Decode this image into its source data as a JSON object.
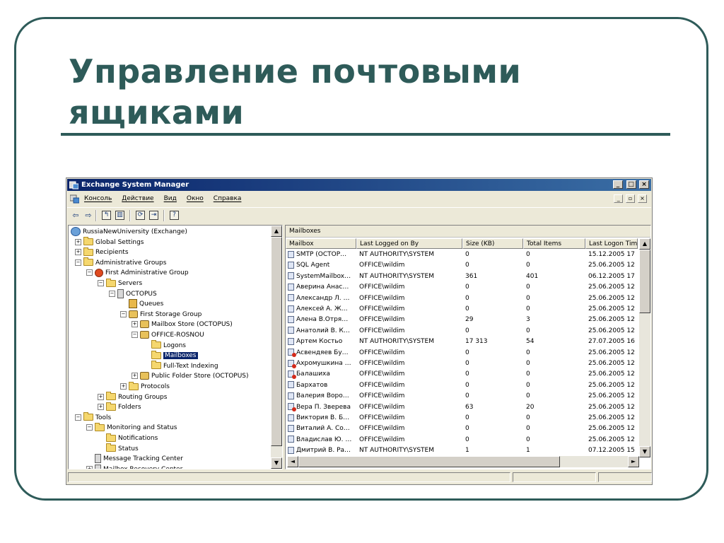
{
  "slide": {
    "title_line1": "Управление почтовыми",
    "title_line2": "ящиками",
    "colors": {
      "accent": "#2e5b59",
      "title_bar": "#0a246a",
      "selection": "#0a246a"
    }
  },
  "window": {
    "title": "Exchange System Manager",
    "caption_buttons": {
      "minimize": "_",
      "maximize": "□",
      "close": "×"
    },
    "menu": [
      "Консоль",
      "Действие",
      "Вид",
      "Окно",
      "Справка"
    ],
    "mdi_buttons": {
      "minimize": "_",
      "restore": "▫",
      "close": "×"
    },
    "toolbar": [
      {
        "name": "back-icon",
        "glyph": "⇦"
      },
      {
        "name": "forward-icon",
        "glyph": "⇨"
      },
      {
        "name": "up-folder-icon",
        "glyph": "↰"
      },
      {
        "name": "show-hide-tree-icon",
        "glyph": "▥"
      },
      {
        "name": "refresh-icon",
        "glyph": "⟳"
      },
      {
        "name": "export-list-icon",
        "glyph": "⇥"
      },
      {
        "name": "help-icon",
        "glyph": "?"
      }
    ]
  },
  "tree": [
    {
      "label": "RussiaNewUniversity (Exchange)",
      "expander": "",
      "icon": "globe"
    },
    {
      "label": "Global Settings",
      "expander": "+",
      "icon": "folder"
    },
    {
      "label": "Recipients",
      "expander": "+",
      "icon": "folder"
    },
    {
      "label": "Administrative Groups",
      "expander": "−",
      "icon": "folder"
    },
    {
      "label": "First Administrative Group",
      "expander": "−",
      "icon": "group"
    },
    {
      "label": "Servers",
      "expander": "−",
      "icon": "folder"
    },
    {
      "label": "OCTOPUS",
      "expander": "−",
      "icon": "server"
    },
    {
      "label": "Queues",
      "expander": "",
      "icon": "queue"
    },
    {
      "label": "First Storage Group",
      "expander": "−",
      "icon": "store"
    },
    {
      "label": "Mailbox Store (OCTOPUS)",
      "expander": "+",
      "icon": "store"
    },
    {
      "label": "OFFICE-ROSNOU",
      "expander": "−",
      "icon": "store"
    },
    {
      "label": "Logons",
      "expander": "",
      "icon": "folder"
    },
    {
      "label": "Mailboxes",
      "expander": "",
      "icon": "folder",
      "selected": true
    },
    {
      "label": "Full-Text Indexing",
      "expander": "",
      "icon": "folder"
    },
    {
      "label": "Public Folder Store (OCTOPUS)",
      "expander": "+",
      "icon": "store"
    },
    {
      "label": "Protocols",
      "expander": "+",
      "icon": "folder"
    },
    {
      "label": "Routing Groups",
      "expander": "+",
      "icon": "folder"
    },
    {
      "label": "Folders",
      "expander": "+",
      "icon": "folder"
    },
    {
      "label": "Tools",
      "expander": "−",
      "icon": "folder"
    },
    {
      "label": "Monitoring and Status",
      "expander": "−",
      "icon": "folder"
    },
    {
      "label": "Notifications",
      "expander": "",
      "icon": "folder"
    },
    {
      "label": "Status",
      "expander": "",
      "icon": "folder"
    },
    {
      "label": "Message Tracking Center",
      "expander": "",
      "icon": "server"
    },
    {
      "label": "Mailbox Recovery Center",
      "expander": "+",
      "icon": "server"
    }
  ],
  "list": {
    "caption": "Mailboxes",
    "columns": [
      "Mailbox",
      "Last Logged on By",
      "Size (KB)",
      "Total Items",
      "Last Logon Time"
    ],
    "rows": [
      {
        "mailbox": "SMTP (OCTOP…",
        "by": "NT AUTHORITY\\SYSTEM",
        "size": "0",
        "items": "0",
        "logon": "15.12.2005 17",
        "err": false
      },
      {
        "mailbox": "SQL Agent",
        "by": "OFFICE\\wildim",
        "size": "0",
        "items": "0",
        "logon": "25.06.2005 12",
        "err": false
      },
      {
        "mailbox": "SystemMailbox…",
        "by": "NT AUTHORITY\\SYSTEM",
        "size": "361",
        "items": "401",
        "logon": "06.12.2005 17",
        "err": false
      },
      {
        "mailbox": "Аверина Анас…",
        "by": "OFFICE\\wildim",
        "size": "0",
        "items": "0",
        "logon": "25.06.2005 12",
        "err": false
      },
      {
        "mailbox": "Александр Л. …",
        "by": "OFFICE\\wildim",
        "size": "0",
        "items": "0",
        "logon": "25.06.2005 12",
        "err": false
      },
      {
        "mailbox": "Алексей А. Ж…",
        "by": "OFFICE\\wildim",
        "size": "0",
        "items": "0",
        "logon": "25.06.2005 12",
        "err": false
      },
      {
        "mailbox": "Алена В.Отря…",
        "by": "OFFICE\\wildim",
        "size": "29",
        "items": "3",
        "logon": "25.06.2005 12",
        "err": false
      },
      {
        "mailbox": "Анатолий В. К…",
        "by": "OFFICE\\wildim",
        "size": "0",
        "items": "0",
        "logon": "25.06.2005 12",
        "err": false
      },
      {
        "mailbox": "Артем Костьо",
        "by": "NT AUTHORITY\\SYSTEM",
        "size": "17 313",
        "items": "54",
        "logon": "27.07.2005 16",
        "err": false
      },
      {
        "mailbox": "Асвендяев Бу…",
        "by": "OFFICE\\wildim",
        "size": "0",
        "items": "0",
        "logon": "25.06.2005 12",
        "err": true
      },
      {
        "mailbox": "Ахромушкина …",
        "by": "OFFICE\\wildim",
        "size": "0",
        "items": "0",
        "logon": "25.06.2005 12",
        "err": true
      },
      {
        "mailbox": "Балашиха",
        "by": "OFFICE\\wildim",
        "size": "0",
        "items": "0",
        "logon": "25.06.2005 12",
        "err": true
      },
      {
        "mailbox": "Бархатов",
        "by": "OFFICE\\wildim",
        "size": "0",
        "items": "0",
        "logon": "25.06.2005 12",
        "err": false
      },
      {
        "mailbox": "Валерия Воро…",
        "by": "OFFICE\\wildim",
        "size": "0",
        "items": "0",
        "logon": "25.06.2005 12",
        "err": false
      },
      {
        "mailbox": "Вера П. Зверева",
        "by": "OFFICE\\wildim",
        "size": "63",
        "items": "20",
        "logon": "25.06.2005 12",
        "err": true
      },
      {
        "mailbox": "Виктория В. Б…",
        "by": "OFFICE\\wildim",
        "size": "0",
        "items": "0",
        "logon": "25.06.2005 12",
        "err": false
      },
      {
        "mailbox": "Виталий А. Со…",
        "by": "OFFICE\\wildim",
        "size": "0",
        "items": "0",
        "logon": "25.06.2005 12",
        "err": false
      },
      {
        "mailbox": "Владислав Ю. …",
        "by": "OFFICE\\wildim",
        "size": "0",
        "items": "0",
        "logon": "25.06.2005 12",
        "err": false
      },
      {
        "mailbox": "Дмитрий В. Ра…",
        "by": "NT AUTHORITY\\SYSTEM",
        "size": "1",
        "items": "1",
        "logon": "07.12.2005 15",
        "err": false
      }
    ]
  }
}
